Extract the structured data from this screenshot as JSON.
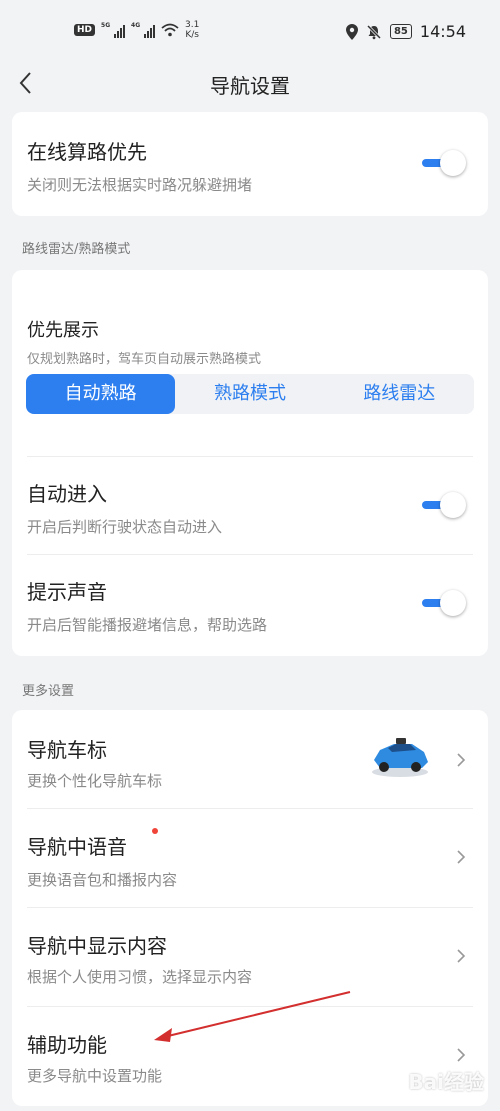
{
  "status_bar": {
    "hd": "HD",
    "net1": "5G",
    "net2": "4G",
    "speed_value": "3.1",
    "speed_unit": "K/s",
    "battery": "85",
    "time": "14:54"
  },
  "header": {
    "title": "导航设置"
  },
  "online_route": {
    "title": "在线算路优先",
    "subtitle": "关闭则无法根据实时路况躲避拥堵",
    "enabled": true
  },
  "radar_section": {
    "label": "路线雷达/熟路模式",
    "priority_title": "优先展示",
    "priority_subtitle": "仅规划熟路时，驾车页自动展示熟路模式",
    "options": [
      "自动熟路",
      "熟路模式",
      "路线雷达"
    ],
    "selected": "自动熟路",
    "auto_enter": {
      "title": "自动进入",
      "subtitle": "开启后判断行驶状态自动进入",
      "enabled": true
    },
    "sound": {
      "title": "提示声音",
      "subtitle": "开启后智能播报避堵信息，帮助选路",
      "enabled": true
    }
  },
  "more_section": {
    "label": "更多设置",
    "items": [
      {
        "title": "导航车标",
        "subtitle": "更换个性化导航车标"
      },
      {
        "title": "导航中语音",
        "subtitle": "更换语音包和播报内容"
      },
      {
        "title": "导航中显示内容",
        "subtitle": "根据个人使用习惯，选择显示内容"
      },
      {
        "title": "辅助功能",
        "subtitle": "更多导航中设置功能"
      }
    ]
  },
  "watermark": "Bai经验",
  "colors": {
    "accent": "#2d7ff0",
    "background": "#f2f3f5",
    "annotation_arrow": "#d32f2f",
    "notify_dot": "#f04438"
  },
  "icons": [
    "back-arrow-icon",
    "chevron-right-icon",
    "car-icon",
    "wifi-icon",
    "location-icon",
    "mute-bell-icon",
    "battery-icon"
  ]
}
